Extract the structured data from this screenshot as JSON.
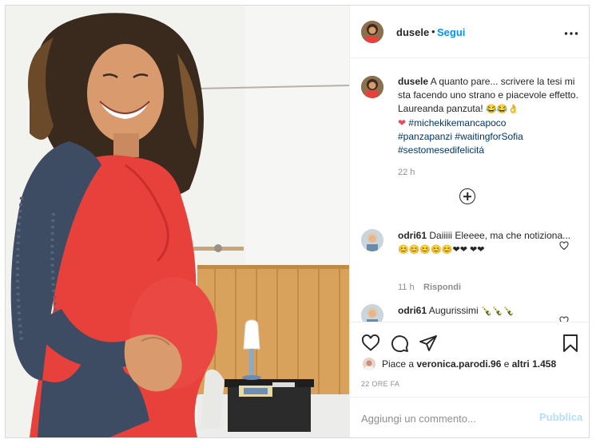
{
  "post": {
    "username": "dusele",
    "dot": "•",
    "follow": "Segui",
    "more": "•••"
  },
  "caption": {
    "username": "dusele",
    "text": "A quanto pare... scrivere la tesi mi sta facendo uno strano e piacevole effetto. Laureanda panzuta!",
    "emoji_end": "😂😂👌",
    "heart": "❤",
    "tags": [
      "#michekikemancapoco",
      "#panzapanzi",
      "#waitingforSofia",
      "#sestomesedifelicitá"
    ],
    "time": "22 h"
  },
  "comments": [
    {
      "username": "odri61",
      "text": "Daiiiii Eleeee, ma che notiziona...",
      "emoji": "😊😊😊😊😊❤❤ ❤❤",
      "time": "11 h",
      "reply": "Rispondi"
    },
    {
      "username": "odri61",
      "text": "Augurissimi",
      "emoji": "🍾🍾🍾"
    }
  ],
  "likes": {
    "prefix": "Piace a ",
    "user": "veronica.parodi.96",
    "middle": " e ",
    "others": "altri 1.458"
  },
  "ago": "22 ORE FA",
  "comment_box": {
    "placeholder": "Aggiungi un commento...",
    "publish": "Pubblica"
  },
  "colors": {
    "link": "#0095f6",
    "hashtag": "#00376b",
    "muted": "#8e8e8e",
    "dress": "#e53a35",
    "cardigan": "#3d4c63"
  }
}
